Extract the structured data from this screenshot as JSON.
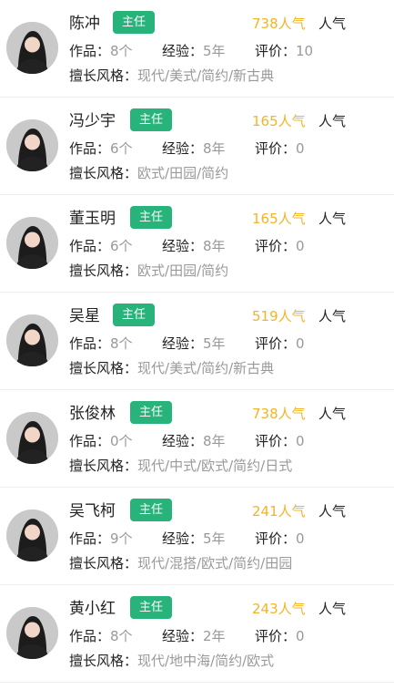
{
  "colors": {
    "badge_bg": "#27b37a",
    "popularity": "#f5b326",
    "value_text": "#999999",
    "label_text": "#222222"
  },
  "labels": {
    "works": "作品：",
    "experience": "经验：",
    "rating": "评价：",
    "styles": "擅长风格：",
    "popularity": "人气"
  },
  "designers": [
    {
      "name": "陈冲",
      "badge": "主任",
      "popularity": "738人气",
      "works": "8个",
      "experience": "5年",
      "rating": "10",
      "styles": "现代/美式/简约/新古典"
    },
    {
      "name": "冯少宇",
      "badge": "主任",
      "popularity": "165人气",
      "works": "6个",
      "experience": "8年",
      "rating": "0",
      "styles": "欧式/田园/简约"
    },
    {
      "name": "董玉明",
      "badge": "主任",
      "popularity": "165人气",
      "works": "6个",
      "experience": "8年",
      "rating": "0",
      "styles": "欧式/田园/简约"
    },
    {
      "name": "吴星",
      "badge": "主任",
      "popularity": "519人气",
      "works": "8个",
      "experience": "5年",
      "rating": "0",
      "styles": "现代/美式/简约/新古典"
    },
    {
      "name": "张俊林",
      "badge": "主任",
      "popularity": "738人气",
      "works": "0个",
      "experience": "8年",
      "rating": "0",
      "styles": "现代/中式/欧式/简约/日式"
    },
    {
      "name": "吴飞柯",
      "badge": "主任",
      "popularity": "241人气",
      "works": "9个",
      "experience": "5年",
      "rating": "0",
      "styles": "现代/混搭/欧式/简约/田园"
    },
    {
      "name": "黄小红",
      "badge": "主任",
      "popularity": "243人气",
      "works": "8个",
      "experience": "2年",
      "rating": "0",
      "styles": "现代/地中海/简约/欧式"
    }
  ]
}
